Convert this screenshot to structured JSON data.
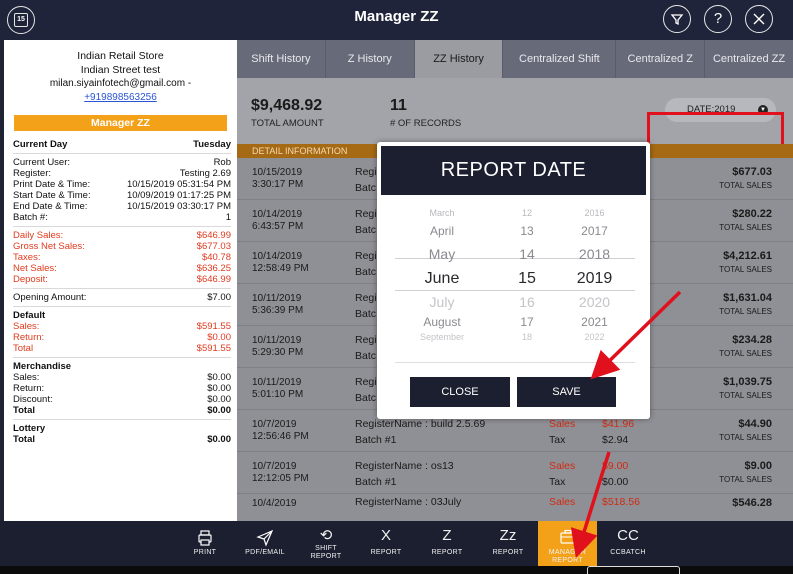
{
  "app": {
    "title": "Manager ZZ",
    "calendar_day": "15",
    "filter_icon": "filter-icon",
    "help_label": "?",
    "close_icon": "close-icon"
  },
  "store": {
    "name": "Indian Retail Store",
    "street": "Indian Street test",
    "email": "milan.siyainfotech@gmail.com -",
    "phone": "+919898563256",
    "manager_band": "Manager ZZ"
  },
  "report": {
    "day_label": "Current Day",
    "day_value": "Tuesday",
    "info": [
      {
        "label": "Current User:",
        "value": "Rob"
      },
      {
        "label": "Register:",
        "value": "Testing 2.69"
      },
      {
        "label": "Print Date & Time:",
        "value": "10/15/2019 05:31:54 PM"
      },
      {
        "label": "Start Date & Time:",
        "value": "10/09/2019 01:17:25 PM"
      },
      {
        "label": "End Date & Time:",
        "value": "10/15/2019 03:30:17 PM"
      },
      {
        "label": "Batch #:",
        "value": "1"
      }
    ],
    "sales": [
      {
        "label": "Daily Sales:",
        "value": "$646.99"
      },
      {
        "label": "Gross Net Sales:",
        "value": "$677.03"
      },
      {
        "label": "Taxes:",
        "value": "$40.78"
      },
      {
        "label": "Net Sales:",
        "value": "$636.25"
      },
      {
        "label": "Deposit:",
        "value": "$646.99"
      }
    ],
    "opening": {
      "label": "Opening Amount:",
      "value": "$7.00"
    },
    "default_title": "Default",
    "default_rows": [
      {
        "label": "Sales:",
        "value": "$591.55"
      },
      {
        "label": "Return:",
        "value": "$0.00"
      },
      {
        "label": "Total",
        "value": "$591.55"
      }
    ],
    "merch_title": "Merchandise",
    "merch_rows": [
      {
        "label": "Sales:",
        "value": "$0.00"
      },
      {
        "label": "Return:",
        "value": "$0.00"
      },
      {
        "label": "Discount:",
        "value": "$0.00"
      }
    ],
    "merch_total": {
      "label": "Total",
      "value": "$0.00"
    },
    "lottery_title": "Lottery",
    "lottery_total": {
      "label": "Total",
      "value": "$0.00"
    }
  },
  "tabs": [
    {
      "label": "Shift History"
    },
    {
      "label": "Z History"
    },
    {
      "label": "ZZ History"
    },
    {
      "label": "Centralized Shift"
    },
    {
      "label": "Centralized Z"
    },
    {
      "label": "Centralized ZZ"
    }
  ],
  "summary": {
    "total_amount": "$9,468.92",
    "total_amount_label": "TOTAL AMOUNT",
    "records": "11",
    "records_label": "# OF RECORDS",
    "date_filter": "DATE:2019"
  },
  "detail_header": "DETAIL INFORMATION",
  "records": [
    {
      "date": "10/15/2019",
      "time": "3:30:17 PM",
      "reg": "Regi",
      "batch": "Batc",
      "total": "$677.03",
      "total_label": "TOTAL SALES"
    },
    {
      "date": "10/14/2019",
      "time": "6:43:57 PM",
      "reg": "Regi",
      "batch": "Batc",
      "total": "$280.22",
      "total_label": "TOTAL SALES"
    },
    {
      "date": "10/14/2019",
      "time": "12:58:49 PM",
      "reg": "Regi",
      "batch": "Batc",
      "total": "$4,212.61",
      "total_label": "TOTAL SALES"
    },
    {
      "date": "10/11/2019",
      "time": "5:36:39 PM",
      "reg": "Regi",
      "batch": "Batc",
      "total": "$1,631.04",
      "total_label": "TOTAL SALES"
    },
    {
      "date": "10/11/2019",
      "time": "5:29:30 PM",
      "reg": "Regi",
      "batch": "Batc",
      "total": "$234.28",
      "total_label": "TOTAL SALES"
    },
    {
      "date": "10/11/2019",
      "time": "5:01:10 PM",
      "reg": "Regi",
      "batch": "Batc",
      "total": "$1,039.75",
      "total_label": "TOTAL SALES"
    },
    {
      "date": "10/7/2019",
      "time": "12:56:46 PM",
      "reg": "RegisterName : build 2.5.69",
      "batch": "Batch #1",
      "sales_label": "Sales",
      "tax_label": "Tax",
      "sales": "$41.96",
      "tax": "$2.94",
      "total": "$44.90",
      "total_label": "TOTAL SALES"
    },
    {
      "date": "10/7/2019",
      "time": "12:12:05 PM",
      "reg": "RegisterName : os13",
      "batch": "Batch #1",
      "sales_label": "Sales",
      "tax_label": "Tax",
      "sales": "$9.00",
      "tax": "$0.00",
      "total": "$9.00",
      "total_label": "TOTAL SALES"
    },
    {
      "date": "10/4/2019",
      "time": "",
      "reg": "RegisterName : 03July",
      "batch": "",
      "sales_label": "Sales",
      "tax_label": "",
      "sales": "$518.56",
      "tax": "",
      "total": "$546.28",
      "total_label": ""
    }
  ],
  "modal": {
    "title": "REPORT DATE",
    "months": [
      "March",
      "April",
      "May",
      "June",
      "July",
      "August",
      "September"
    ],
    "days": [
      "12",
      "13",
      "14",
      "15",
      "16",
      "17",
      "18"
    ],
    "years": [
      "2016",
      "2017",
      "2018",
      "2019",
      "2020",
      "2021",
      "2022"
    ],
    "selected_index": 3,
    "close_label": "CLOSE",
    "save_label": "SAVE"
  },
  "toolbar": [
    {
      "label": "PRINT",
      "icon": "printer-icon"
    },
    {
      "label": "PDF/EMAIL",
      "icon": "send-icon"
    },
    {
      "label": "SHIFT REPORT",
      "icon": "shift-icon"
    },
    {
      "label": "REPORT",
      "icon": "x-report-icon",
      "glyph": "X"
    },
    {
      "label": "REPORT",
      "icon": "z-report-icon",
      "glyph": "Z"
    },
    {
      "label": "REPORT",
      "icon": "zz-report-icon",
      "glyph": "Zz"
    },
    {
      "label": "MANAGER REPORT",
      "icon": "briefcase-icon"
    },
    {
      "label": "CCBATCH",
      "icon": "cc-icon",
      "glyph": "CC"
    }
  ],
  "colors": {
    "accent": "#f4a11a",
    "header": "#1c1f30",
    "highlight": "#e0101c",
    "sales_red": "#e03a1e"
  }
}
